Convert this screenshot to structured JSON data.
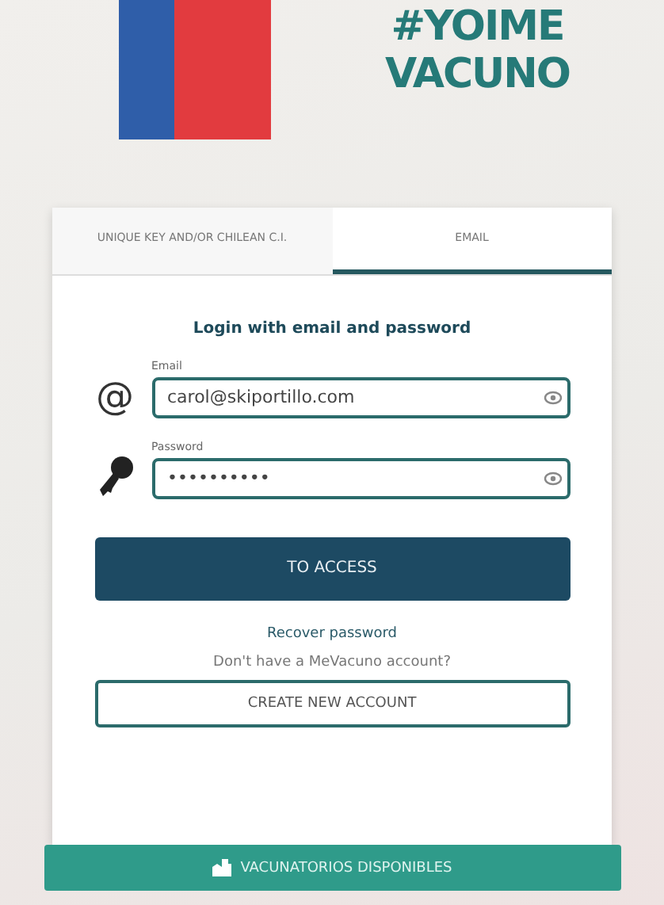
{
  "logos": {
    "campaign_line_1": "#YOIME",
    "campaign_line_2": "VACUNO"
  },
  "tabs": [
    {
      "label": "UNIQUE KEY AND/OR CHILEAN C.I.",
      "selected": false
    },
    {
      "label": "EMAIL",
      "selected": true
    }
  ],
  "form": {
    "title": "Login with email and password",
    "email": {
      "icon": "@",
      "label": "Email",
      "value": "carol@skiportillo.com"
    },
    "password": {
      "label": "Password",
      "value": "••••••••••"
    },
    "submit": "TO ACCESS",
    "recover": "Recover password",
    "no_account": "Don't have a MeVacuno account?",
    "create": "CREATE NEW ACCOUNT"
  },
  "bottom_button": "VACUNATORIOS DISPONIBLES"
}
